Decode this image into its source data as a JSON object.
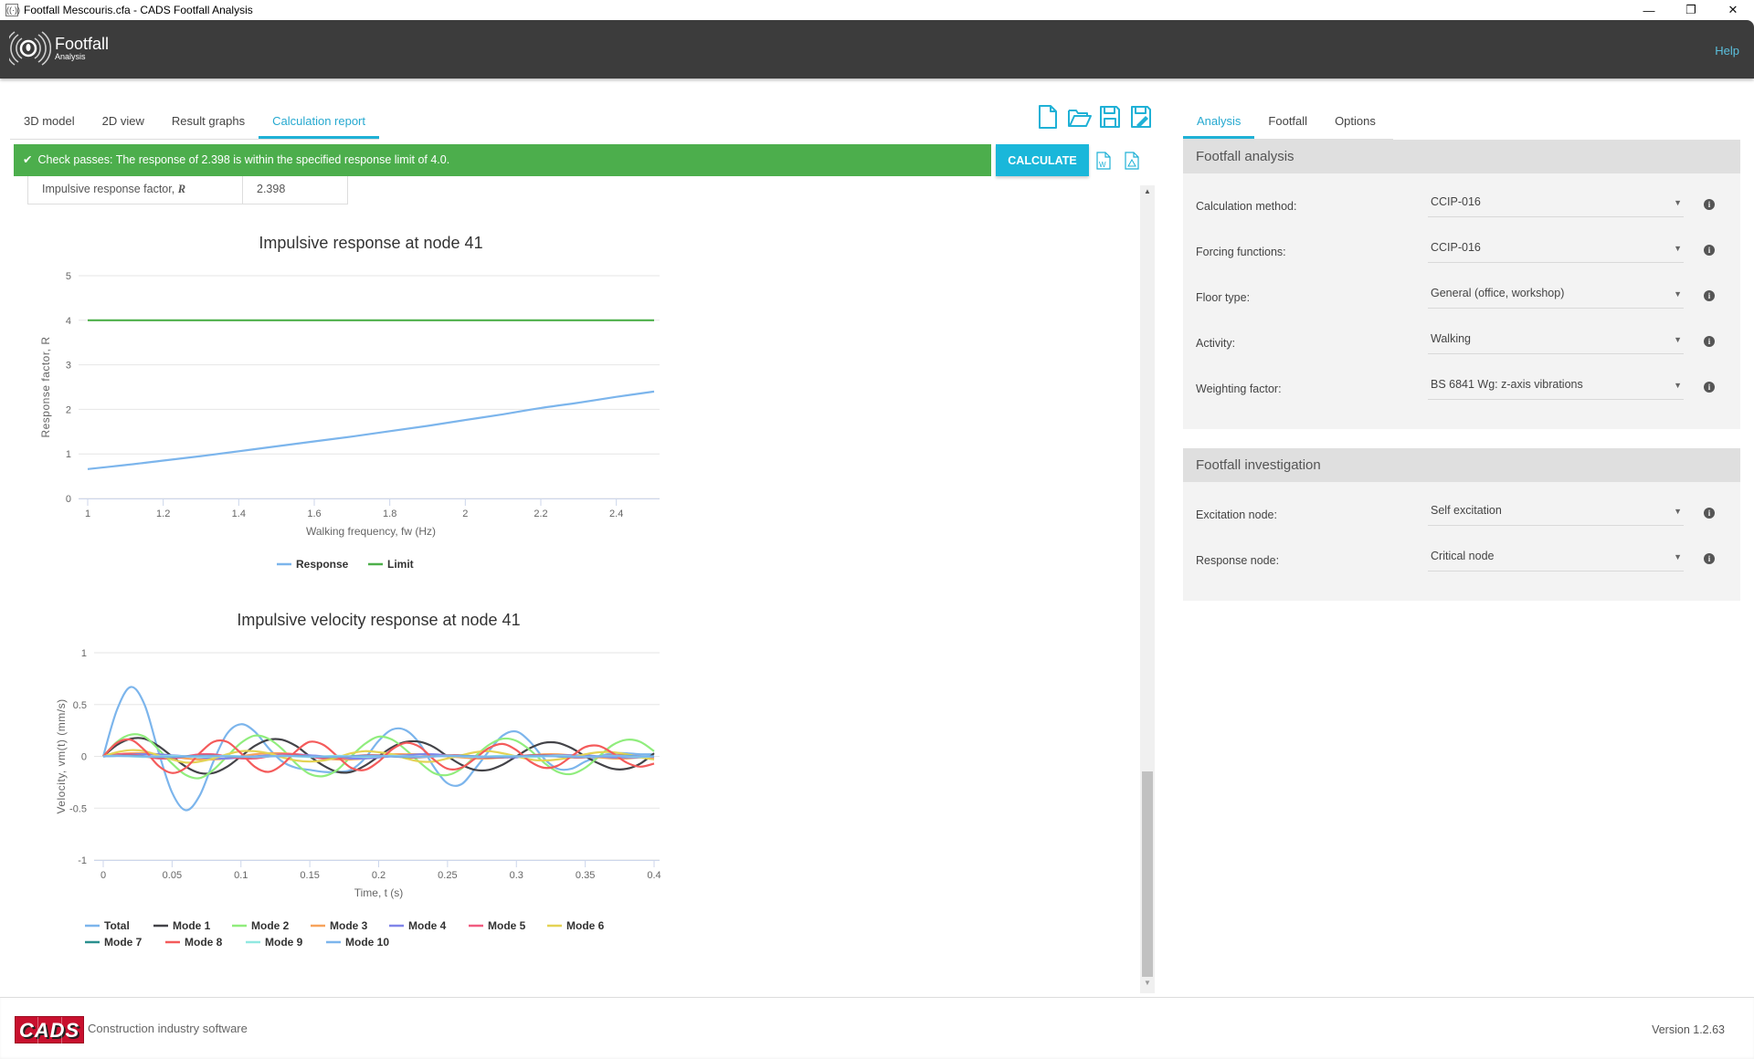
{
  "window": {
    "title": "Footfall Mescouris.cfa - CADS Footfall Analysis",
    "controls": {
      "minimize": "—",
      "restore": "❐",
      "close": "✕"
    }
  },
  "header": {
    "logo_title": "Footfall",
    "logo_subtitle": "Analysis",
    "help_label": "Help"
  },
  "left_tabs": [
    {
      "label": "3D model",
      "active": false
    },
    {
      "label": "2D view",
      "active": false
    },
    {
      "label": "Result graphs",
      "active": false
    },
    {
      "label": "Calculation report",
      "active": true
    }
  ],
  "file_icons": [
    "new-file-icon",
    "open-folder-icon",
    "save-icon",
    "save-as-icon"
  ],
  "status": {
    "check_icon": "✔",
    "message": "Check passes: The response of 2.398 is within the specified response limit of 4.0.",
    "color": "#4cae4c"
  },
  "calculate_label": "CALCULATE",
  "export_icons": [
    "word-export-icon",
    "pdf-export-icon"
  ],
  "report": {
    "row_label": "Impulsive response factor, ",
    "row_symbol": "R",
    "row_value": "2.398"
  },
  "right_tabs": [
    {
      "label": "Analysis",
      "active": true
    },
    {
      "label": "Footfall",
      "active": false
    },
    {
      "label": "Options",
      "active": false
    }
  ],
  "footfall_analysis": {
    "title": "Footfall analysis",
    "fields": [
      {
        "label": "Calculation method:",
        "value": "CCIP-016"
      },
      {
        "label": "Forcing functions:",
        "value": "CCIP-016"
      },
      {
        "label": "Floor type:",
        "value": "General (office, workshop)"
      },
      {
        "label": "Activity:",
        "value": "Walking"
      },
      {
        "label": "Weighting factor:",
        "value": "BS 6841 Wg: z-axis vibrations"
      }
    ]
  },
  "footfall_investigation": {
    "title": "Footfall investigation",
    "fields": [
      {
        "label": "Excitation node:",
        "value": "Self excitation"
      },
      {
        "label": "Response node:",
        "value": "Critical node"
      }
    ]
  },
  "footer": {
    "brand": "CADS",
    "tagline": "Construction industry software",
    "version": "Version 1.2.63"
  },
  "chart_data": [
    {
      "type": "line",
      "title": "Impulsive response at node 41",
      "xlabel": "Walking frequency, fw (Hz)",
      "ylabel": "Response factor, R",
      "xlim": [
        1,
        2.5
      ],
      "ylim": [
        0,
        5
      ],
      "xticks": [
        1,
        1.2,
        1.4,
        1.6,
        1.8,
        2,
        2.2,
        2.4
      ],
      "yticks": [
        0,
        1,
        2,
        3,
        4,
        5
      ],
      "grid": true,
      "legend": "bottom-center",
      "x": [
        1.0,
        1.1,
        1.2,
        1.3,
        1.4,
        1.5,
        1.6,
        1.7,
        1.8,
        1.9,
        2.0,
        2.1,
        2.2,
        2.3,
        2.4,
        2.5
      ],
      "series": [
        {
          "name": "Response",
          "color": "#7cb5ec",
          "values": [
            0.66,
            0.75,
            0.85,
            0.95,
            1.06,
            1.17,
            1.28,
            1.39,
            1.51,
            1.63,
            1.76,
            1.89,
            2.03,
            2.15,
            2.28,
            2.4
          ]
        },
        {
          "name": "Limit",
          "color": "#4daf4a",
          "values": [
            4,
            4,
            4,
            4,
            4,
            4,
            4,
            4,
            4,
            4,
            4,
            4,
            4,
            4,
            4,
            4
          ]
        }
      ]
    },
    {
      "type": "line",
      "title": "Impulsive velocity response at node 41",
      "xlabel": "Time, t (s)",
      "ylabel": "Velocity, vm(t) (mm/s)",
      "xlim": [
        0,
        0.4
      ],
      "ylim": [
        -1,
        1
      ],
      "xticks": [
        0,
        0.05,
        0.1,
        0.15,
        0.2,
        0.25,
        0.3,
        0.35,
        0.4
      ],
      "yticks": [
        -1,
        -0.5,
        0,
        0.5,
        1
      ],
      "grid": true,
      "legend": "bottom-left",
      "x": [
        0,
        0.01,
        0.02,
        0.03,
        0.04,
        0.05,
        0.06,
        0.07,
        0.08,
        0.09,
        0.1,
        0.11,
        0.12,
        0.13,
        0.14,
        0.15,
        0.16,
        0.17,
        0.18,
        0.19,
        0.2,
        0.21,
        0.22,
        0.23,
        0.24,
        0.25,
        0.26,
        0.27,
        0.28,
        0.29,
        0.3,
        0.31,
        0.32,
        0.33,
        0.34,
        0.35,
        0.36,
        0.37,
        0.38,
        0.39,
        0.4
      ],
      "series": [
        {
          "name": "Total",
          "color": "#7cb5ec",
          "values": [
            0,
            0.45,
            0.67,
            0.5,
            0.05,
            -0.35,
            -0.52,
            -0.38,
            -0.05,
            0.22,
            0.31,
            0.24,
            0.08,
            -0.05,
            -0.11,
            -0.13,
            -0.15,
            -0.15,
            -0.13,
            -0.02,
            0.15,
            0.26,
            0.25,
            0.12,
            -0.1,
            -0.26,
            -0.27,
            -0.12,
            0.05,
            0.2,
            0.24,
            0.14,
            -0.02,
            -0.12,
            -0.12,
            -0.05,
            0,
            0.03,
            0.03,
            0.02,
            0.02
          ]
        },
        {
          "name": "Mode 1",
          "color": "#434348",
          "values": [
            0,
            0.11,
            0.17,
            0.17,
            0.1,
            0,
            -0.1,
            -0.16,
            -0.16,
            -0.1,
            0,
            0.1,
            0.16,
            0.16,
            0.1,
            0,
            -0.09,
            -0.15,
            -0.15,
            -0.09,
            0,
            0.09,
            0.14,
            0.14,
            0.09,
            0,
            -0.08,
            -0.13,
            -0.13,
            -0.08,
            0,
            0.08,
            0.13,
            0.13,
            0.08,
            0,
            -0.07,
            -0.12,
            -0.12,
            -0.07,
            0.03
          ]
        },
        {
          "name": "Mode 2",
          "color": "#90ed7d",
          "values": [
            0,
            0.14,
            0.21,
            0.19,
            0.07,
            -0.07,
            -0.18,
            -0.21,
            -0.13,
            0,
            0.13,
            0.2,
            0.17,
            0.07,
            -0.07,
            -0.17,
            -0.19,
            -0.13,
            0,
            0.12,
            0.19,
            0.16,
            0.06,
            -0.06,
            -0.16,
            -0.18,
            -0.12,
            0,
            0.11,
            0.17,
            0.15,
            0.06,
            -0.06,
            -0.15,
            -0.17,
            -0.11,
            0,
            0.11,
            0.16,
            0.14,
            0.05
          ]
        },
        {
          "name": "Mode 3",
          "color": "#f7a35c",
          "values": [
            0,
            0.02,
            0.03,
            0.03,
            0.02,
            0,
            -0.02,
            -0.03,
            -0.03,
            -0.02,
            0,
            0.02,
            0.03,
            0.03,
            0.02,
            0,
            -0.02,
            -0.03,
            -0.03,
            -0.02,
            0,
            0.02,
            0.02,
            0.02,
            0.01,
            0,
            -0.01,
            -0.02,
            -0.02,
            -0.01,
            0,
            0.01,
            0.02,
            0.02,
            0.01,
            0,
            -0.01,
            -0.02,
            -0.02,
            -0.01,
            0
          ]
        },
        {
          "name": "Mode 4",
          "color": "#8085e9",
          "values": [
            0,
            0.01,
            0.02,
            0.02,
            0.02,
            0.01,
            0,
            -0.01,
            -0.02,
            -0.02,
            -0.01,
            0,
            0.01,
            0.02,
            0.02,
            0.01,
            0,
            -0.01,
            -0.02,
            -0.02,
            -0.01,
            0,
            0.01,
            0.02,
            0.02,
            0.01,
            0,
            -0.01,
            -0.01,
            -0.01,
            -0.01,
            0,
            0.01,
            0.01,
            0.01,
            0.01,
            0,
            -0.01,
            -0.01,
            -0.01,
            0
          ]
        },
        {
          "name": "Mode 5",
          "color": "#f15c80",
          "values": [
            0,
            0.02,
            0.02,
            0,
            -0.02,
            -0.02,
            0,
            0.02,
            0.02,
            0,
            -0.02,
            -0.02,
            0,
            0.02,
            0.02,
            0,
            -0.02,
            -0.02,
            0,
            0.01,
            0.01,
            0,
            -0.01,
            -0.01,
            0,
            0.01,
            0.01,
            0,
            -0.01,
            -0.01,
            0,
            0.01,
            0.01,
            0,
            -0.01,
            -0.01,
            0,
            0.01,
            0.01,
            0,
            -0.01
          ]
        },
        {
          "name": "Mode 6",
          "color": "#e4d354",
          "values": [
            0,
            0.04,
            0.06,
            0.05,
            0.01,
            -0.03,
            -0.06,
            -0.05,
            -0.02,
            0.02,
            0.05,
            0.05,
            0.03,
            -0.01,
            -0.04,
            -0.05,
            -0.04,
            -0.01,
            0.03,
            0.05,
            0.04,
            0.02,
            -0.02,
            -0.05,
            -0.05,
            -0.02,
            0.01,
            0.04,
            0.05,
            0.03,
            0,
            -0.03,
            -0.04,
            -0.03,
            -0.01,
            0.02,
            0.04,
            0.04,
            0.02,
            -0.01,
            -0.03
          ]
        },
        {
          "name": "Mode 7",
          "color": "#2b908f",
          "values": [
            0,
            0.005,
            0.005,
            0,
            -0.005,
            -0.005,
            0,
            0.005,
            0.005,
            0,
            -0.005,
            -0.005,
            0,
            0.005,
            0.005,
            0,
            -0.005,
            -0.005,
            0,
            0.005,
            0.005,
            0,
            -0.005,
            -0.005,
            0,
            0.005,
            0.005,
            0,
            -0.005,
            -0.005,
            0,
            0.005,
            0.005,
            0,
            -0.005,
            -0.005,
            0,
            0.005,
            0.005,
            0,
            0
          ]
        },
        {
          "name": "Mode 8",
          "color": "#f45b5b",
          "values": [
            0,
            0.13,
            0.16,
            0.06,
            -0.09,
            -0.16,
            -0.11,
            0.03,
            0.14,
            0.14,
            0.03,
            -0.1,
            -0.15,
            -0.08,
            0.05,
            0.14,
            0.11,
            0,
            -0.11,
            -0.13,
            -0.05,
            0.07,
            0.13,
            0.09,
            -0.03,
            -0.12,
            -0.11,
            -0.02,
            0.08,
            0.12,
            0.06,
            -0.05,
            -0.11,
            -0.09,
            0,
            0.09,
            0.1,
            0.03,
            -0.06,
            -0.1,
            -0.07
          ]
        },
        {
          "name": "Mode 9",
          "color": "#91e8e1",
          "values": [
            0,
            0.005,
            0,
            -0.005,
            0,
            0.005,
            0,
            -0.005,
            0,
            0.005,
            0,
            -0.005,
            0,
            0.005,
            0,
            -0.005,
            0,
            0.005,
            0,
            -0.005,
            0,
            0.005,
            0,
            -0.005,
            0,
            0.005,
            0,
            -0.005,
            0,
            0.005,
            0,
            -0.005,
            0,
            0.005,
            0,
            -0.005,
            0,
            0.005,
            0,
            -0.005,
            0
          ]
        },
        {
          "name": "Mode 10",
          "color": "#7cb5ec",
          "values": [
            0,
            0.003,
            0.003,
            0,
            -0.003,
            -0.003,
            0,
            0.003,
            0.003,
            0,
            -0.003,
            -0.003,
            0,
            0.003,
            0.003,
            0,
            -0.003,
            -0.003,
            0,
            0.003,
            0.003,
            0,
            -0.003,
            -0.003,
            0,
            0.003,
            0.003,
            0,
            -0.003,
            -0.003,
            0,
            0.003,
            0.003,
            0,
            -0.003,
            -0.003,
            0,
            0.003,
            0.003,
            0,
            0
          ]
        }
      ]
    }
  ]
}
